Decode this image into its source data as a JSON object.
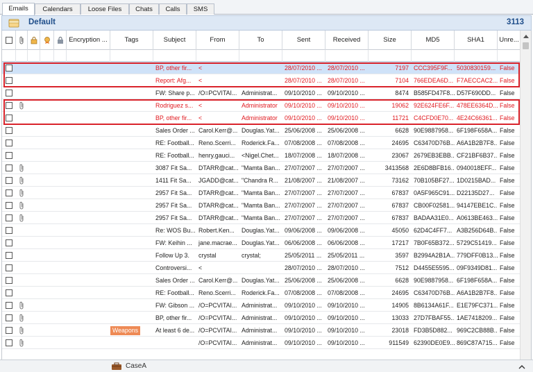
{
  "tabs": [
    "Emails",
    "Calendars",
    "Loose Files",
    "Chats",
    "Calls",
    "SMS"
  ],
  "header": {
    "title": "Default",
    "count": "3113"
  },
  "columns": {
    "encryption": "Encryption ...",
    "tags": "Tags",
    "subject": "Subject",
    "from": "From",
    "to": "To",
    "sent": "Sent",
    "received": "Received",
    "size": "Size",
    "md5": "MD5",
    "sha1": "SHA1",
    "unread": "Unre..."
  },
  "header_icons": [
    "attachment-icon",
    "lock-icon",
    "certificate-icon",
    "encrypted-icon"
  ],
  "rows": [
    {
      "attach": false,
      "tag": "",
      "subject": "BP, other fir...",
      "from": "<",
      "to": "",
      "sent": "28/07/2010 ...",
      "received": "28/07/2010 ...",
      "size": "7197",
      "md5": "CCC395F9F...",
      "sha1": "5030830159...",
      "unread": "False",
      "red": true,
      "selected": true
    },
    {
      "attach": false,
      "tag": "",
      "subject": "Report: Afg...",
      "from": "<",
      "to": "",
      "sent": "28/07/2010 ...",
      "received": "28/07/2010 ...",
      "size": "7104",
      "md5": "766EDEA6D...",
      "sha1": "F7AECCAC2...",
      "unread": "False",
      "red": true,
      "selected": false
    },
    {
      "attach": false,
      "tag": "",
      "subject": "FW: Share p...",
      "from": "/O=PCVITAI...",
      "to": "Administrat...",
      "sent": "09/10/2010 ...",
      "received": "09/10/2010 ...",
      "size": "8474",
      "md5": "B585FD47F8...",
      "sha1": "D57F690DD...",
      "unread": "False",
      "red": false,
      "selected": false
    },
    {
      "attach": true,
      "tag": "",
      "subject": "Rodriguez s...",
      "from": "<",
      "to": "Administrator",
      "sent": "09/10/2010 ...",
      "received": "09/10/2010 ...",
      "size": "19062",
      "md5": "92E624FE6F...",
      "sha1": "478EE6364D...",
      "unread": "False",
      "red": true,
      "selected": false
    },
    {
      "attach": false,
      "tag": "",
      "subject": "BP, other fir...",
      "from": "<",
      "to": "Administrator",
      "sent": "09/10/2010 ...",
      "received": "09/10/2010 ...",
      "size": "11721",
      "md5": "C4CFD0E70...",
      "sha1": "4E24C66361...",
      "unread": "False",
      "red": true,
      "selected": false
    },
    {
      "attach": false,
      "tag": "",
      "subject": "Sales Order ...",
      "from": "Carol.Kerr@...",
      "to": "Douglas.Yat...",
      "sent": "25/06/2008 ...",
      "received": "25/06/2008 ...",
      "size": "6628",
      "md5": "90E9887958...",
      "sha1": "6F198F658A...",
      "unread": "False",
      "red": false,
      "selected": false
    },
    {
      "attach": false,
      "tag": "",
      "subject": "RE: Football...",
      "from": "Reno.Scerri...",
      "to": "Roderick.Fa...",
      "sent": "07/08/2008 ...",
      "received": "07/08/2008 ...",
      "size": "24695",
      "md5": "C63470D76B...",
      "sha1": "A6A1B2B7F8...",
      "unread": "False",
      "red": false,
      "selected": false
    },
    {
      "attach": false,
      "tag": "",
      "subject": "RE: Football...",
      "from": "henry.gauci...",
      "to": "<Nigel.Chet...",
      "sent": "18/07/2008 ...",
      "received": "18/07/2008 ...",
      "size": "23067",
      "md5": "2679EB3EBB...",
      "sha1": "CF21BF6B37...",
      "unread": "False",
      "red": false,
      "selected": false
    },
    {
      "attach": true,
      "tag": "",
      "subject": "3087 Fit Sa...",
      "from": "DTARR@cat...",
      "to": "\"Mamta Ban...",
      "sent": "27/07/2007 ...",
      "received": "27/07/2007 ...",
      "size": "3413568",
      "md5": "2E6D8BFB16...",
      "sha1": "0940018EFF...",
      "unread": "False",
      "red": false,
      "selected": false
    },
    {
      "attach": true,
      "tag": "",
      "subject": "1411 Fit Sa...",
      "from": "JGADD@cat...",
      "to": "\"Chandra R...",
      "sent": "21/08/2007 ...",
      "received": "21/08/2007 ...",
      "size": "73162",
      "md5": "70B105BF27...",
      "sha1": "1D0215BAD...",
      "unread": "False",
      "red": false,
      "selected": false
    },
    {
      "attach": true,
      "tag": "",
      "subject": "2957 Fit Sa...",
      "from": "DTARR@cat...",
      "to": "\"Mamta Ban...",
      "sent": "27/07/2007 ...",
      "received": "27/07/2007 ...",
      "size": "67837",
      "md5": "0A5F965C91...",
      "sha1": "D22135D27...",
      "unread": "False",
      "red": false,
      "selected": false
    },
    {
      "attach": true,
      "tag": "",
      "subject": "2957 Fit Sa...",
      "from": "DTARR@cat...",
      "to": "\"Mamta Ban...",
      "sent": "27/07/2007 ...",
      "received": "27/07/2007 ...",
      "size": "67837",
      "md5": "CB00F02581...",
      "sha1": "94147EBE1C...",
      "unread": "False",
      "red": false,
      "selected": false
    },
    {
      "attach": true,
      "tag": "",
      "subject": "2957 Fit Sa...",
      "from": "DTARR@cat...",
      "to": "\"Mamta Ban...",
      "sent": "27/07/2007 ...",
      "received": "27/07/2007 ...",
      "size": "67837",
      "md5": "BADAA31E0...",
      "sha1": "A0613BE463...",
      "unread": "False",
      "red": false,
      "selected": false
    },
    {
      "attach": false,
      "tag": "",
      "subject": "Re: WOS Bu...",
      "from": "Robert.Ken...",
      "to": "Douglas.Yat...",
      "sent": "09/06/2008 ...",
      "received": "09/06/2008 ...",
      "size": "45050",
      "md5": "62D4C4FF7...",
      "sha1": "A3B256D64B...",
      "unread": "False",
      "red": false,
      "selected": false
    },
    {
      "attach": false,
      "tag": "",
      "subject": "FW: Keihin ...",
      "from": "jane.macrae...",
      "to": "Douglas.Yat...",
      "sent": "06/06/2008 ...",
      "received": "06/06/2008 ...",
      "size": "17217",
      "md5": "7B0F65B372...",
      "sha1": "5729C51419...",
      "unread": "False",
      "red": false,
      "selected": false
    },
    {
      "attach": false,
      "tag": "",
      "subject": "Follow Up 3.",
      "from": "crystal",
      "to": "crystal;",
      "sent": "25/05/2011 ...",
      "received": "25/05/2011 ...",
      "size": "3597",
      "md5": "B2994A2B1A...",
      "sha1": "779DFF0B13...",
      "unread": "False",
      "red": false,
      "selected": false
    },
    {
      "attach": false,
      "tag": "",
      "subject": "Controversi...",
      "from": "<",
      "to": "",
      "sent": "28/07/2010 ...",
      "received": "28/07/2010 ...",
      "size": "7512",
      "md5": "D4455E5595...",
      "sha1": "09F9349D81...",
      "unread": "False",
      "red": false,
      "selected": false
    },
    {
      "attach": false,
      "tag": "",
      "subject": "Sales Order ...",
      "from": "Carol.Kerr@...",
      "to": "Douglas.Yat...",
      "sent": "25/06/2008 ...",
      "received": "25/06/2008 ...",
      "size": "6628",
      "md5": "90E9887958...",
      "sha1": "6F198F658A...",
      "unread": "False",
      "red": false,
      "selected": false
    },
    {
      "attach": false,
      "tag": "",
      "subject": "RE: Football...",
      "from": "Reno.Scerri...",
      "to": "Roderick.Fa...",
      "sent": "07/08/2008 ...",
      "received": "07/08/2008 ...",
      "size": "24695",
      "md5": "C63470D76B...",
      "sha1": "A6A1B2B7F8...",
      "unread": "False",
      "red": false,
      "selected": false
    },
    {
      "attach": true,
      "tag": "",
      "subject": "FW: Gibson ...",
      "from": "/O=PCVITAI...",
      "to": "Administrat...",
      "sent": "09/10/2010 ...",
      "received": "09/10/2010 ...",
      "size": "14905",
      "md5": "8B6134A61F...",
      "sha1": "E1E79FC371...",
      "unread": "False",
      "red": false,
      "selected": false
    },
    {
      "attach": true,
      "tag": "",
      "subject": "BP, other fir...",
      "from": "/O=PCVITAI...",
      "to": "Administrat...",
      "sent": "09/10/2010 ...",
      "received": "09/10/2010 ...",
      "size": "13033",
      "md5": "27D7FBAF55...",
      "sha1": "1AE7418209...",
      "unread": "False",
      "red": false,
      "selected": false
    },
    {
      "attach": true,
      "tag": "Weapons",
      "subject": "At least 6 de...",
      "from": "/O=PCVITAI...",
      "to": "Administrat...",
      "sent": "09/10/2010 ...",
      "received": "09/10/2010 ...",
      "size": "23018",
      "md5": "FD3B5D882...",
      "sha1": "969C2CB88B...",
      "unread": "False",
      "red": false,
      "selected": false
    },
    {
      "attach": true,
      "tag": "",
      "subject": "",
      "from": "/O=PCVITAI...",
      "to": "Administrat...",
      "sent": "09/10/2010 ...",
      "received": "09/10/2010 ...",
      "size": "911549",
      "md5": "62390DE0E9...",
      "sha1": "869C87A715...",
      "unread": "False",
      "red": false,
      "selected": false
    }
  ],
  "footer": {
    "case_label": "CaseA"
  },
  "colors": {
    "header_bg": "#dde8f5",
    "title": "#1f4e8a",
    "red_text": "#e0191f",
    "selection": "#cfe2f8",
    "tag_bg": "#ee8a55"
  }
}
